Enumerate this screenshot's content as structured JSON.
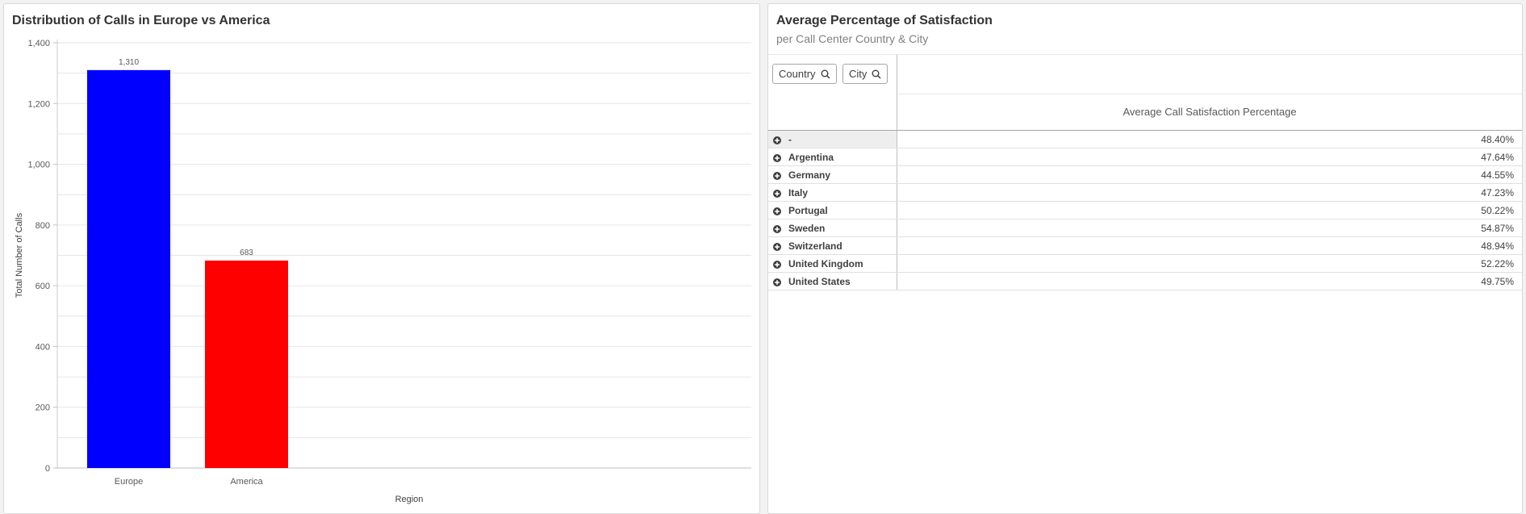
{
  "left_panel": {
    "title": "Distribution of Calls in Europe vs America"
  },
  "chart_data": {
    "type": "bar",
    "title": "Distribution of Calls in Europe vs America",
    "categories": [
      "Europe",
      "America"
    ],
    "values": [
      1310,
      683
    ],
    "value_labels": [
      "1,310",
      "683"
    ],
    "colors": [
      "#0000ff",
      "#ff0000"
    ],
    "xlabel": "Region",
    "ylabel": "Total Number of Calls",
    "ylim": [
      0,
      1400
    ],
    "yticks": [
      0,
      200,
      400,
      600,
      800,
      1000,
      1200,
      1400
    ],
    "ytick_labels": [
      "0",
      "200",
      "400",
      "600",
      "800",
      "1,000",
      "1,200",
      "1,400"
    ],
    "grid": true
  },
  "right_panel": {
    "title": "Average Percentage of Satisfaction",
    "subtitle": "per Call Center Country & City",
    "dimension_buttons": [
      {
        "label": "Country",
        "icon": "search-icon"
      },
      {
        "label": "City",
        "icon": "search-icon"
      }
    ],
    "measure_header": "Average Call Satisfaction Percentage",
    "rows": [
      {
        "label": "-",
        "value": "48.40%"
      },
      {
        "label": "Argentina",
        "value": "47.64%"
      },
      {
        "label": "Germany",
        "value": "44.55%"
      },
      {
        "label": "Italy",
        "value": "47.23%"
      },
      {
        "label": "Portugal",
        "value": "50.22%"
      },
      {
        "label": "Sweden",
        "value": "54.87%"
      },
      {
        "label": "Switzerland",
        "value": "48.94%"
      },
      {
        "label": "United Kingdom",
        "value": "52.22%"
      },
      {
        "label": "United States",
        "value": "49.75%"
      }
    ],
    "row_icon": "plus-circle-icon"
  }
}
